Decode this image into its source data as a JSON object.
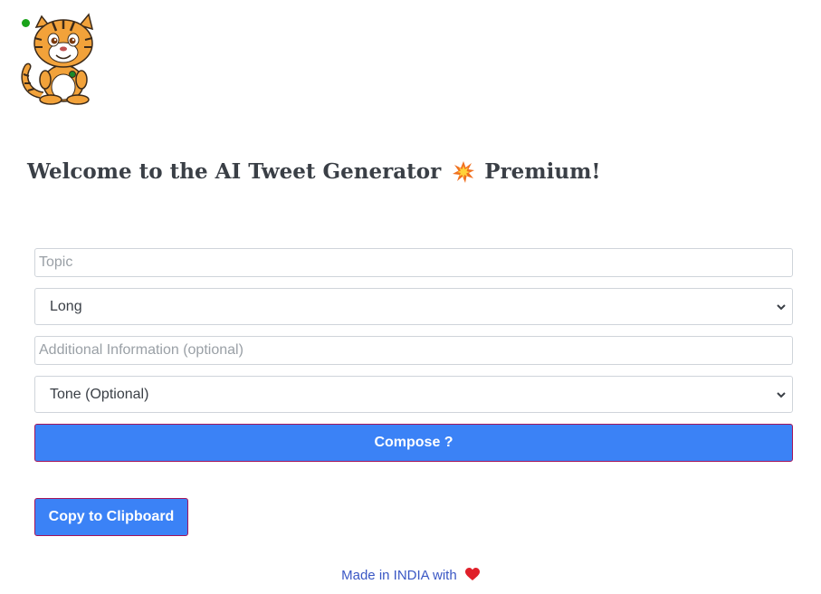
{
  "header": {
    "logo_name": "tiger-mascot-logo",
    "status_color": "#1aa31a"
  },
  "main": {
    "title_part1": "Welcome to the AI Tweet Generator",
    "title_part2": "Premium!",
    "burst_icon": "collision-icon"
  },
  "form": {
    "topic_placeholder": "Topic",
    "length_selected": "Long",
    "additional_placeholder": "Additional Information (optional)",
    "tone_selected": "Tone (Optional)",
    "compose_label": "Compose ?",
    "copy_label": "Copy to Clipboard"
  },
  "footer": {
    "text": "Made in INDIA with",
    "heart_icon": "heart-icon"
  },
  "colors": {
    "accent": "#3b82f6",
    "button_border": "#a3145a",
    "footer_link": "#3a57c4",
    "title": "#3a3f46"
  }
}
